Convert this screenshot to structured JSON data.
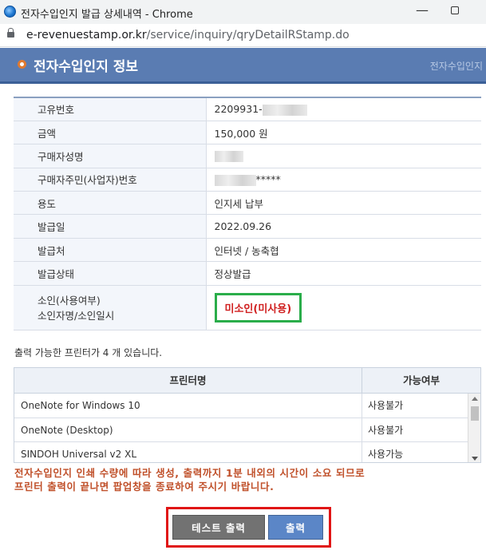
{
  "window": {
    "title": "전자수입인지 발급 상세내역 - Chrome",
    "min_glyph": "—"
  },
  "urlbar": {
    "host": "e-revenuestamp.or.kr",
    "path": "/service/inquiry/qryDetailRStamp.do"
  },
  "header": {
    "title": "전자수입인지 정보",
    "right_text": "전자수입인지"
  },
  "info": [
    {
      "label": "고유번호",
      "value": "2209931-"
    },
    {
      "label": "금액",
      "value": "150,000 원"
    },
    {
      "label": "구매자성명",
      "value": ""
    },
    {
      "label": "구매자주민(사업자)번호",
      "value": "*****"
    },
    {
      "label": "용도",
      "value": "인지세 납부"
    },
    {
      "label": "발급일",
      "value": "2022.09.26"
    },
    {
      "label": "발급처",
      "value": "인터넷 / 농축협"
    },
    {
      "label": "발급상태",
      "value": "정상발급"
    }
  ],
  "stamp": {
    "label_line1": "소인(사용여부)",
    "label_line2": "소인자명/소인일시",
    "value": "미소인(미사용)"
  },
  "printer_info": "출력 가능한 프린터가 4 개 있습니다.",
  "printers": {
    "headers": [
      "프린터명",
      "가능여부"
    ],
    "rows": [
      [
        "OneNote for Windows 10",
        "사용불가"
      ],
      [
        "OneNote (Desktop)",
        "사용불가"
      ],
      [
        "SINDOH Universal v2 XL",
        "사용가능"
      ]
    ]
  },
  "notice": {
    "line1": "전자수입인지 인쇄 수량에 따라 생성, 출력까지 1분 내외의 시간이 소요 되므로",
    "line2": "프린터 출력이 끝나면 팝업창을 종료하여 주시기 바랍니다."
  },
  "buttons": {
    "test_print": "테스트 출력",
    "print": "출력"
  },
  "colors": {
    "header": "#5a7cb2",
    "notice": "#c0502a",
    "stamp_text": "#d02020",
    "highlight_green": "#2aad4a",
    "highlight_red": "#e01515"
  }
}
